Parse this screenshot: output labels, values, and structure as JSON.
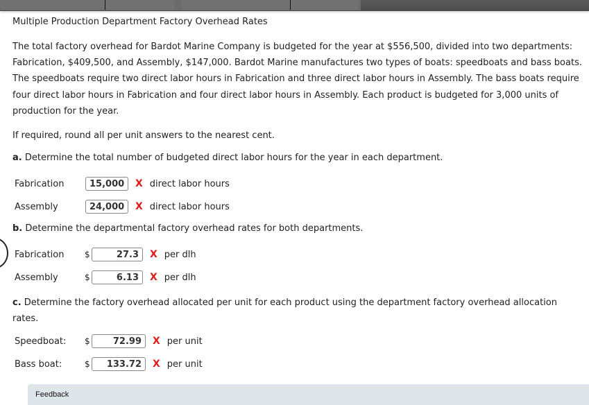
{
  "header": {
    "title": "Multiple Production Department Factory Overhead Rates"
  },
  "problem": {
    "paragraph": "The total factory overhead for Bardot Marine Company is budgeted for the year at $556,500, divided into two departments: Fabrication, $409,500, and Assembly, $147,000. Bardot Marine manufactures two types of boats: speedboats and bass boats. The speedboats require two direct labor hours in Fabrication and three direct labor hours in Assembly. The bass boats require four direct labor hours in Fabrication and four direct labor hours in Assembly. Each product is budgeted for 3,000 units of production for the year.",
    "rounding_note": "If required, round all per unit answers to the nearest cent."
  },
  "part_a": {
    "letter": "a.",
    "prompt": "Determine the total number of budgeted direct labor hours for the year in each department.",
    "rows": [
      {
        "label": "Fabrication",
        "value": "15,000",
        "status": "incorrect",
        "mark": "X",
        "unit": "direct labor hours"
      },
      {
        "label": "Assembly",
        "value": "24,000",
        "status": "incorrect",
        "mark": "X",
        "unit": "direct labor hours"
      }
    ]
  },
  "part_b": {
    "letter": "b.",
    "prompt": "Determine the departmental factory overhead rates for both departments.",
    "rows": [
      {
        "label": "Fabrication",
        "currency": "$",
        "value": "27.3",
        "status": "incorrect",
        "mark": "X",
        "unit": "per dlh"
      },
      {
        "label": "Assembly",
        "currency": "$",
        "value": "6.13",
        "status": "incorrect",
        "mark": "X",
        "unit": "per dlh"
      }
    ]
  },
  "part_c": {
    "letter": "c.",
    "prompt": "Determine the factory overhead allocated per unit for each product using the department factory overhead allocation rates.",
    "rows": [
      {
        "label": "Speedboat:",
        "currency": "$",
        "value": "72.99",
        "status": "incorrect",
        "mark": "X",
        "unit": "per unit"
      },
      {
        "label": "Bass boat:",
        "currency": "$",
        "value": "133.72",
        "status": "incorrect",
        "mark": "X",
        "unit": "per unit"
      }
    ]
  },
  "feedback": {
    "label": "Feedback"
  },
  "colors": {
    "incorrect": "#e01b1b",
    "feedback_bg": "#dfe6ea",
    "toolbar": "#6b6b6b"
  }
}
